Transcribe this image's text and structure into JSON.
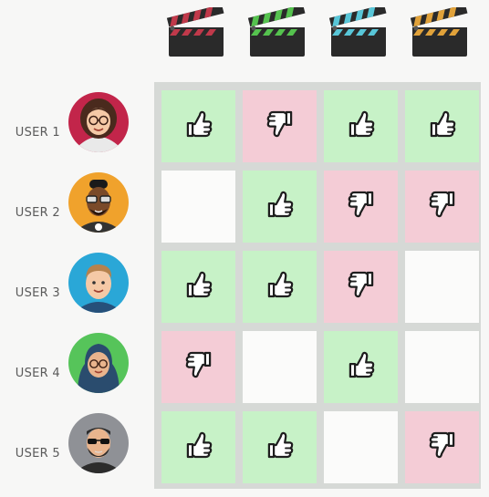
{
  "colors": {
    "like_bg": "#c7f2c7",
    "dislike_bg": "#f4ccd6",
    "empty_bg": "#fbfbfa",
    "grid_bg": "#d6d9d6",
    "thumb_stroke": "#1e1e1e"
  },
  "movies": [
    {
      "icon": "clapperboard-icon",
      "stripe_color": "#c0394a"
    },
    {
      "icon": "clapperboard-icon",
      "stripe_color": "#55c24e"
    },
    {
      "icon": "clapperboard-icon",
      "stripe_color": "#58c6d8"
    },
    {
      "icon": "clapperboard-icon",
      "stripe_color": "#e1a23a"
    }
  ],
  "users": [
    {
      "label": "USER 1",
      "avatar": "avatar-woman-red-bg",
      "bg": "#c2254a",
      "ratings": [
        "like",
        "dislike",
        "like",
        "like"
      ]
    },
    {
      "label": "USER 2",
      "avatar": "avatar-man-glasses-orange-bg",
      "bg": "#f0a22c",
      "ratings": [
        "none",
        "like",
        "dislike",
        "dislike"
      ]
    },
    {
      "label": "USER 3",
      "avatar": "avatar-man-blue-bg",
      "bg": "#2aa7d7",
      "ratings": [
        "like",
        "like",
        "dislike",
        "none"
      ]
    },
    {
      "label": "USER 4",
      "avatar": "avatar-woman-hijab-green-bg",
      "bg": "#56c45a",
      "ratings": [
        "dislike",
        "none",
        "like",
        "none"
      ]
    },
    {
      "label": "USER 5",
      "avatar": "avatar-man-beard-gray-bg",
      "bg": "#8f9196",
      "ratings": [
        "like",
        "like",
        "none",
        "dislike"
      ]
    }
  ]
}
